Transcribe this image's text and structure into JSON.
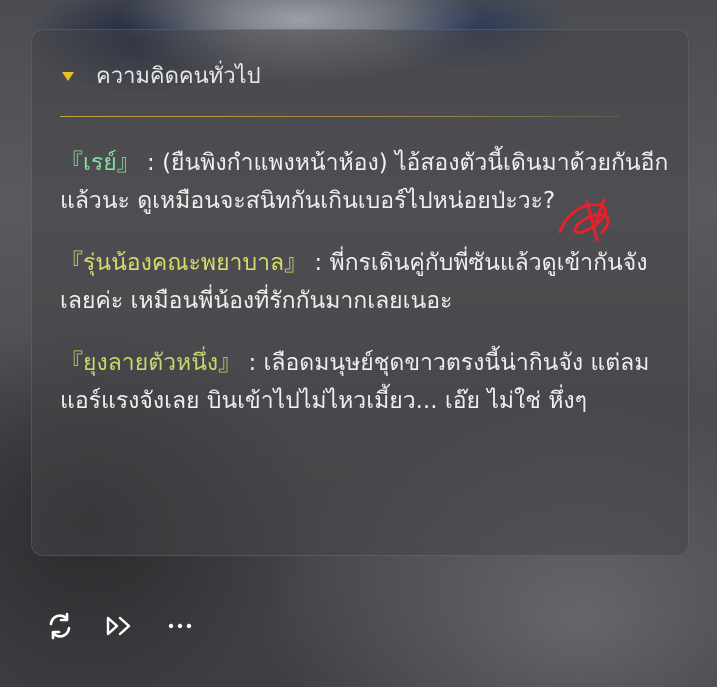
{
  "panel": {
    "title": "ความคิดคนทั่วไป",
    "accent_color": "#e8c21a"
  },
  "entries": [
    {
      "speaker": "『เรย์』",
      "text": " : (ยืนพิงกำแพงหน้าห้อง) ไอ้สองตัวนี้เดินมาด้วยกันอีกแล้วนะ ดูเหมือนจะสนิทกันเกินเบอร์ไปหน่อยป่ะวะ?",
      "speaker_color": "#7ee39a"
    },
    {
      "speaker": "『รุ่นน้องคณะพยาบาล』",
      "text": " : พี่กรเดินคู่กับพี่ซันแล้วดูเข้ากันจังเลยค่ะ เหมือนพี่น้องที่รักกันมากเลยเนอะ",
      "speaker_color": "#d8dc6a"
    },
    {
      "speaker": "『ยุงลายตัวหนึ่ง』",
      "text": " : เลือดมนุษย์ชุดขาวตรงนี้น่ากินจัง แต่ลมแอร์แรงจังเลย บินเข้าไปไม่ไหวเมี้ยว... เอ๊ย ไม่ใช่ หึ่งๆ",
      "speaker_color": "#c8d96a"
    }
  ],
  "controls": {
    "regenerate_icon": "refresh-icon",
    "continue_icon": "fast-forward-icon",
    "more_icon": "more-dots-icon"
  }
}
